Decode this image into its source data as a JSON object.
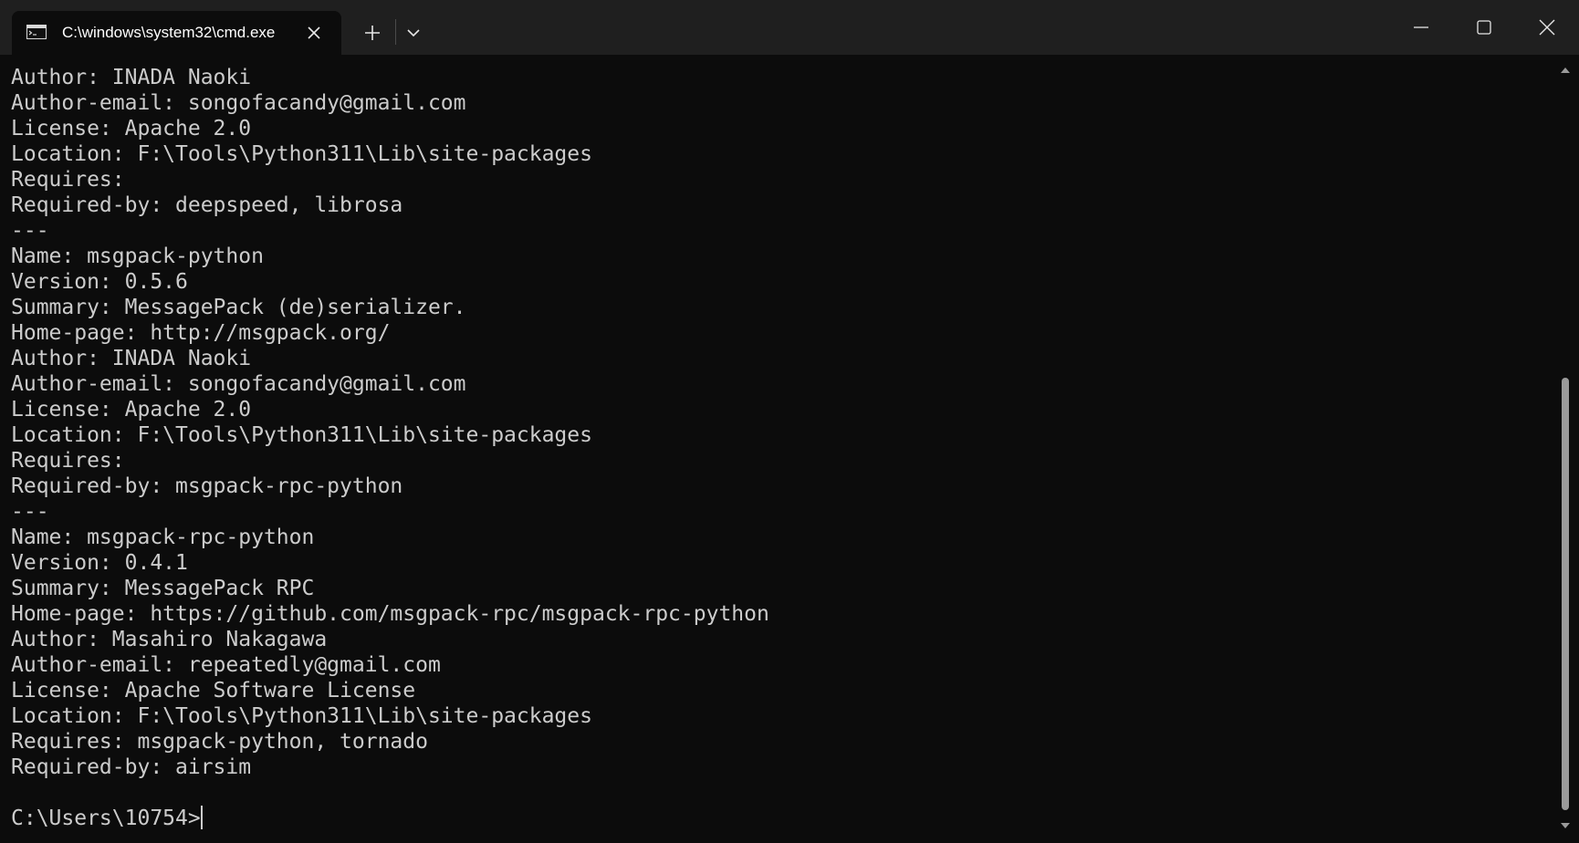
{
  "window": {
    "tab_title": "C:\\windows\\system32\\cmd.exe",
    "tab_icon": "terminal-icon",
    "new_tab_icon": "plus-icon",
    "dropdown_icon": "chevron-down-icon",
    "controls": [
      "minimize-icon",
      "maximize-icon",
      "close-icon"
    ]
  },
  "terminal": {
    "lines": [
      "Author: INADA Naoki",
      "Author-email: songofacandy@gmail.com",
      "License: Apache 2.0",
      "Location: F:\\Tools\\Python311\\Lib\\site-packages",
      "Requires:",
      "Required-by: deepspeed, librosa",
      "---",
      "Name: msgpack-python",
      "Version: 0.5.6",
      "Summary: MessagePack (de)serializer.",
      "Home-page: http://msgpack.org/",
      "Author: INADA Naoki",
      "Author-email: songofacandy@gmail.com",
      "License: Apache 2.0",
      "Location: F:\\Tools\\Python311\\Lib\\site-packages",
      "Requires:",
      "Required-by: msgpack-rpc-python",
      "---",
      "Name: msgpack-rpc-python",
      "Version: 0.4.1",
      "Summary: MessagePack RPC",
      "Home-page: https://github.com/msgpack-rpc/msgpack-rpc-python",
      "Author: Masahiro Nakagawa",
      "Author-email: repeatedly@gmail.com",
      "License: Apache Software License",
      "Location: F:\\Tools\\Python311\\Lib\\site-packages",
      "Requires: msgpack-python, tornado",
      "Required-by: airsim",
      "",
      "C:\\Users\\10754>"
    ]
  },
  "colors": {
    "background": "#0c0c0c",
    "titlebar": "#1f1f1f",
    "text": "#cccccc",
    "scroll_thumb": "#9a9a9a"
  }
}
